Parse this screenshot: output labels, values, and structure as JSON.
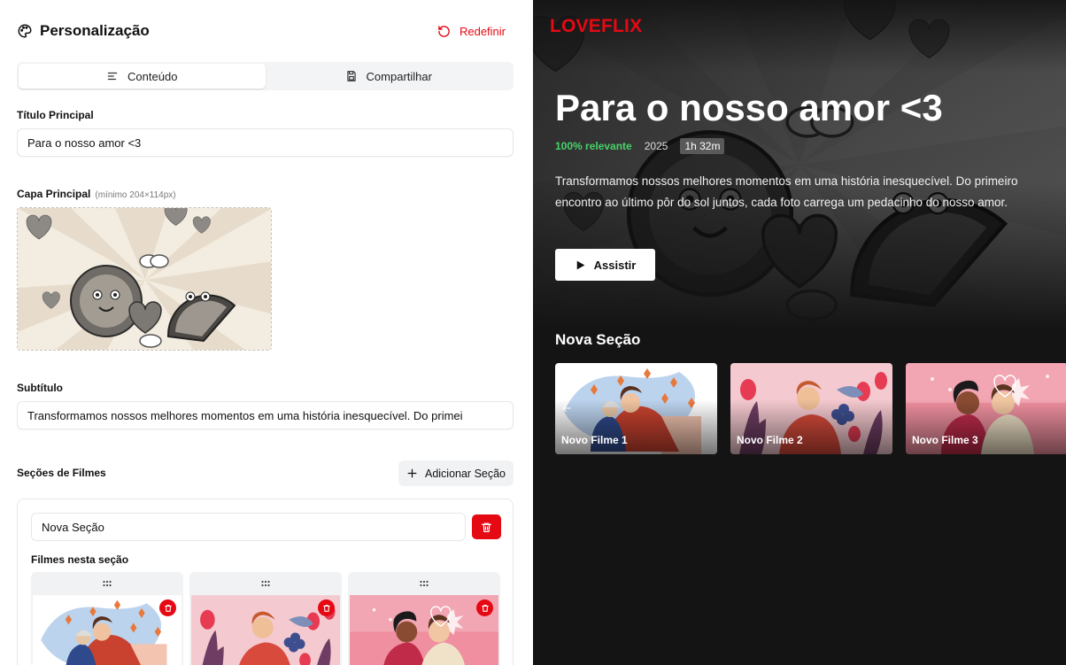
{
  "editor": {
    "title": "Personalização",
    "reset_label": "Redefinir",
    "tabs": [
      {
        "label": "Conteúdo",
        "icon": "align-left-icon",
        "active": true
      },
      {
        "label": "Compartilhar",
        "icon": "save-icon",
        "active": false
      }
    ],
    "main_title": {
      "label": "Título Principal",
      "value": "Para o nosso amor <3"
    },
    "cover": {
      "label": "Capa Principal",
      "hint": "(mínimo 204×114px)"
    },
    "subtitle": {
      "label": "Subtítulo",
      "value": "Transformamos nossos melhores momentos em uma história inesquecível. Do primei"
    },
    "sections": {
      "label": "Seções de Filmes",
      "add_label": "Adicionar Seção",
      "items": [
        {
          "name": "Nova Seção",
          "films_label": "Filmes nesta seção"
        }
      ]
    }
  },
  "preview": {
    "brand": "LOVEFLIX",
    "title": "Para o nosso amor <3",
    "relevance": "100% relevante",
    "year": "2025",
    "duration": "1h 32m",
    "description": "Transformamos nossos melhores momentos em uma história inesquecível. Do primeiro encontro ao último pôr do sol juntos, cada foto carrega um pedacinho do nosso amor.",
    "watch_label": "Assistir",
    "row": {
      "title": "Nova Seção",
      "cards": [
        {
          "label": "Novo Filme 1"
        },
        {
          "label": "Novo Filme 2"
        },
        {
          "label": "Novo Filme 3"
        }
      ]
    }
  },
  "colors": {
    "accent_red": "#e50914",
    "relevance_green": "#46d369",
    "preview_bg": "#141414"
  }
}
